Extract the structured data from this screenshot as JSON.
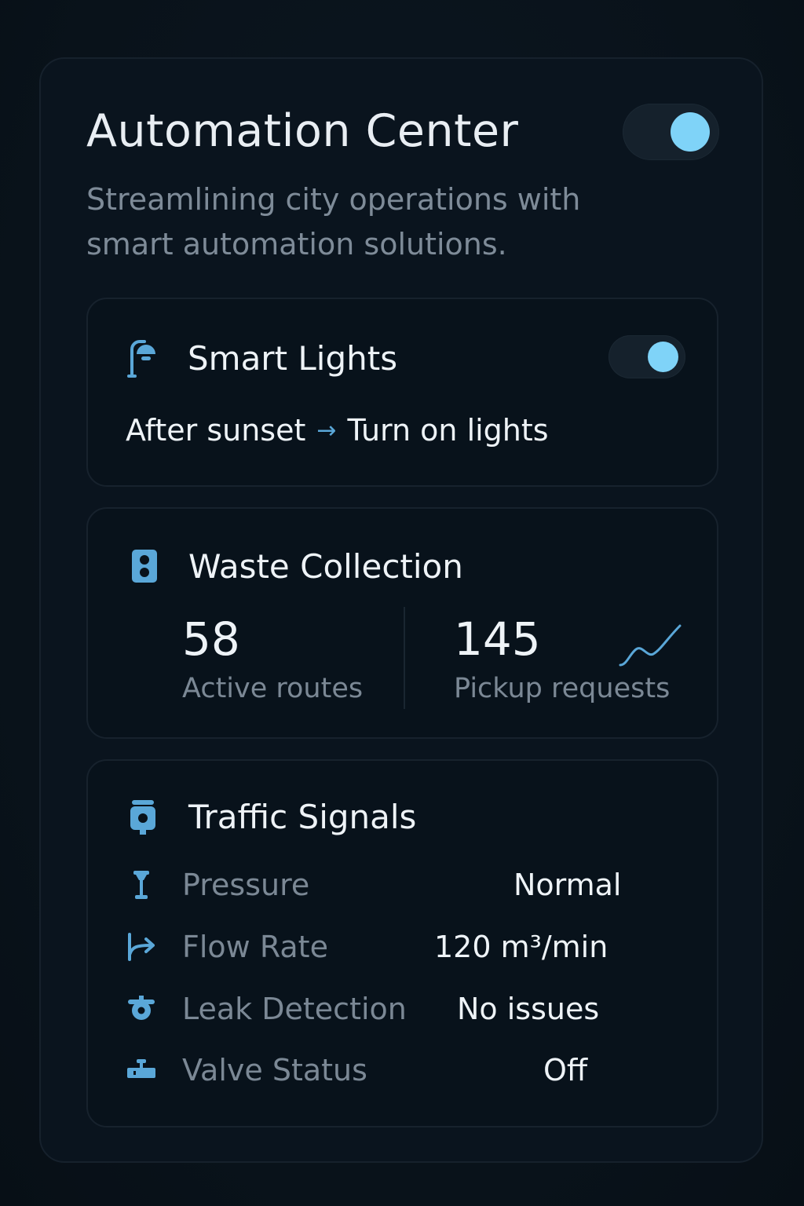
{
  "header": {
    "title": "Automation Center",
    "subtitle": "Streamlining city operations with smart automation solutions.",
    "master_toggle_on": true
  },
  "smart_lights": {
    "title": "Smart Lights",
    "icon": "street-lamp-icon",
    "toggle_on": true,
    "trigger": "After sunset",
    "arrow": "→",
    "action": "Turn on lights"
  },
  "waste_collection": {
    "title": "Waste Collection",
    "icon": "bin-icon",
    "active_routes": {
      "value": "58",
      "label": "Active routes"
    },
    "pickup_requests": {
      "value": "145",
      "label": "Pickup requests"
    },
    "trend_icon": "trend-line-icon"
  },
  "traffic_signals": {
    "title": "Traffic Signals",
    "icon": "traffic-signal-icon",
    "metrics": [
      {
        "label": "Pressure",
        "value": "Normal",
        "icon": "pressure-gauge-icon"
      },
      {
        "label": "Flow Rate",
        "value": "120 m³/min",
        "icon": "flow-arrow-icon"
      },
      {
        "label": "Leak Detection",
        "value": "No issues",
        "icon": "leak-sensor-icon"
      },
      {
        "label": "Valve Status",
        "value": "Off",
        "icon": "valve-icon"
      }
    ]
  },
  "colors": {
    "accent": "#7fd3f8",
    "icon_blue": "#5aa7d8",
    "background": "#0b141d",
    "text_primary": "#eef3f7",
    "text_secondary": "#7b8895"
  }
}
